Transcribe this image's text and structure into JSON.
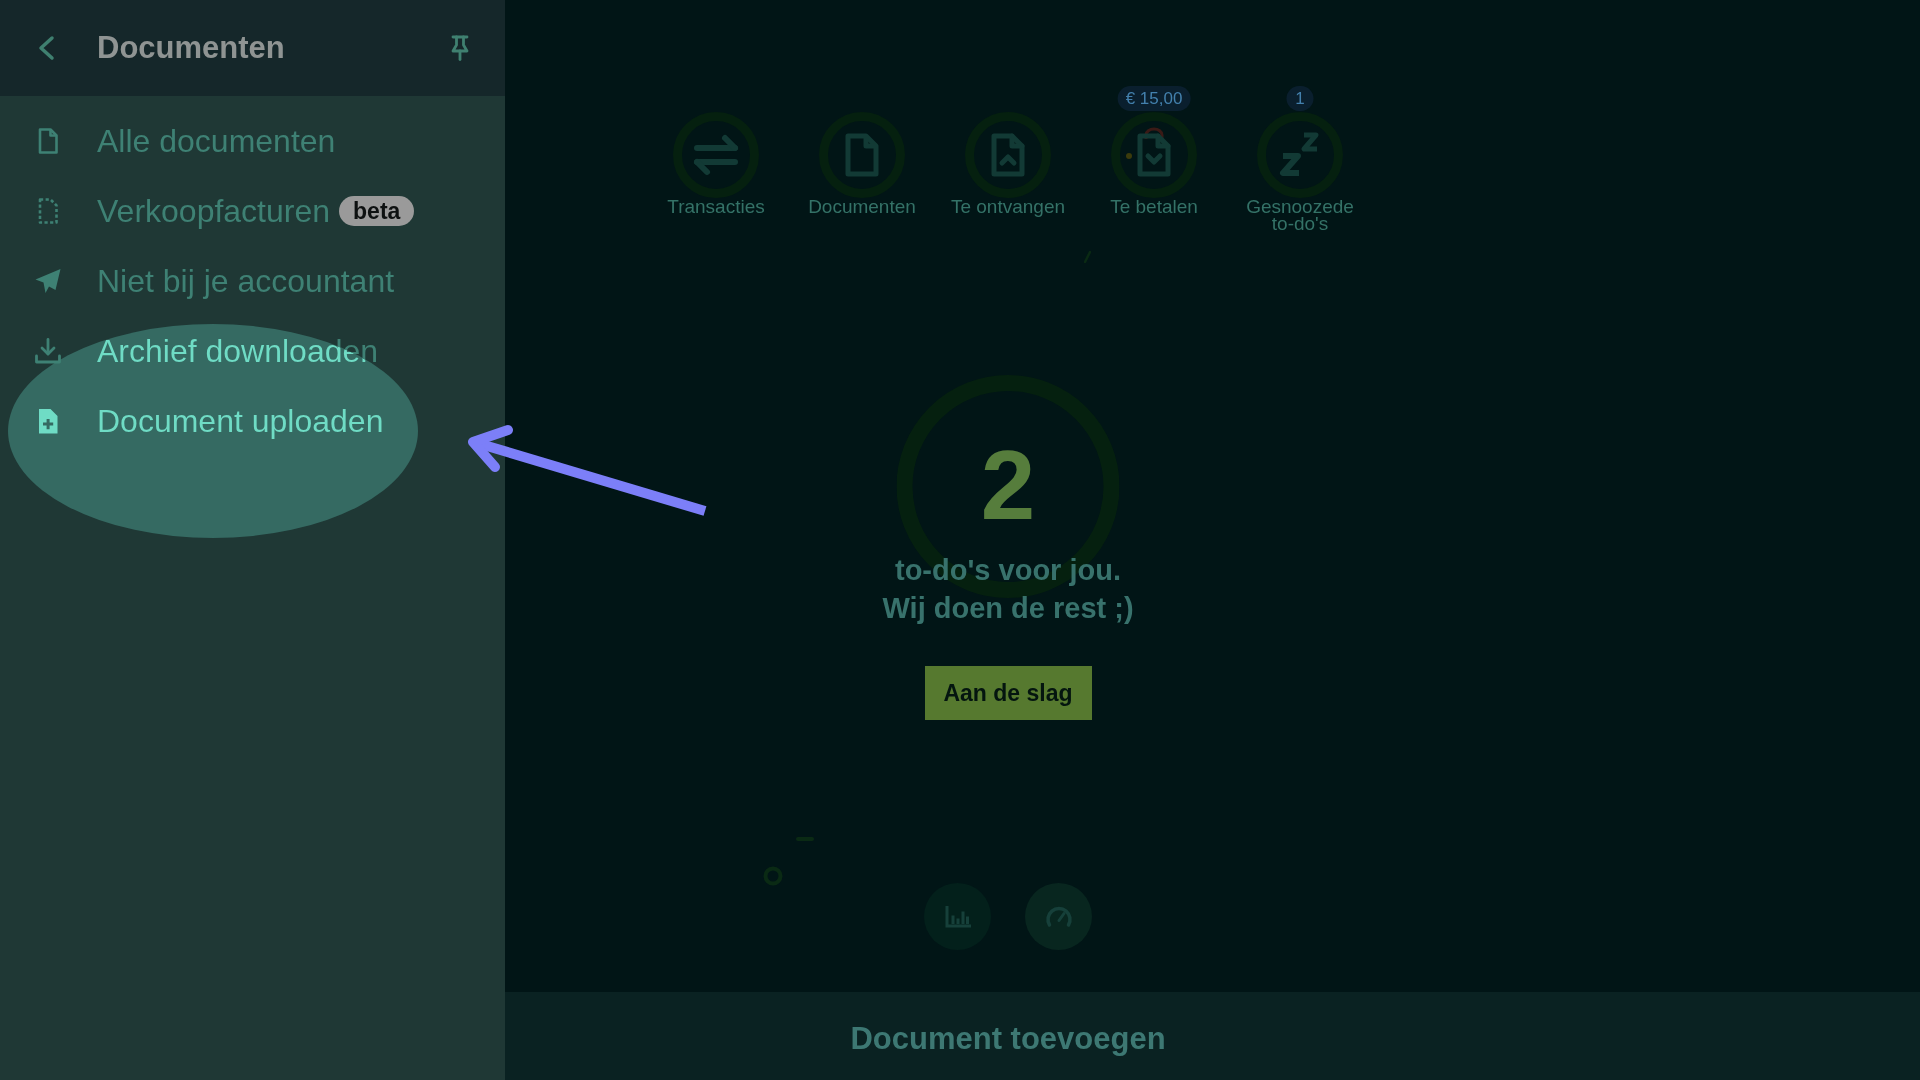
{
  "sidebar": {
    "title": "Documenten",
    "items": [
      {
        "label": "Alle documenten",
        "highlighted": false
      },
      {
        "label": "Verkoopfacturen",
        "badge": "beta",
        "highlighted": false
      },
      {
        "label": "Niet bij je accountant",
        "highlighted": false
      },
      {
        "label": "Archief downloaden",
        "highlighted": false
      },
      {
        "label": "Document uploaden",
        "highlighted": true
      }
    ]
  },
  "shortcuts": [
    {
      "label": "Transacties"
    },
    {
      "label": "Documenten"
    },
    {
      "label": "Te ontvangen"
    },
    {
      "label": "Te betalen",
      "badge": "€ 15,00"
    },
    {
      "label": "Gesnoozede to-do's",
      "badge": "1"
    }
  ],
  "todo": {
    "count": "2",
    "message": "to-do's voor jou.\nWij doen de rest ;)",
    "button": "Aan de slag"
  },
  "annotations": [
    {
      "kind": "arrow"
    }
  ],
  "footer": {
    "title": "Document toevoegen"
  }
}
